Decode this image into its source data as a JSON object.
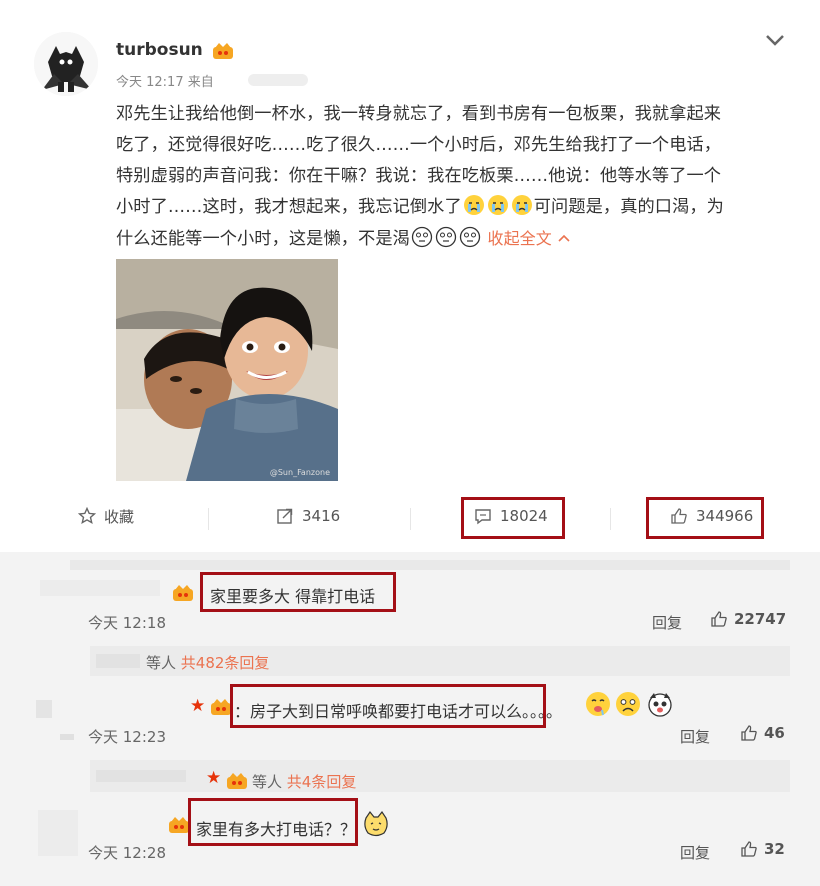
{
  "post": {
    "username": "turbosun",
    "time": "今天 12:17 来自",
    "lines": [
      "邓先生让我给他倒一杯水，我一转身就忘了，看到书房有一包板栗，我就拿起来",
      "吃了，还觉得很好吃……吃了很久……一个小时后，邓先生给我打了一个电话，",
      "特别虚弱的声音问我：你在干嘛？我说：我在吃板栗……他说：他等水等了一个",
      "小时了……这时，我才想起来，我忘记倒水了",
      "可问题是，真的口渴，为",
      "什么还能等一个小时，这是懒，不是渴"
    ],
    "collapse_label": "收起全文",
    "photo_watermark": "@Sun_Fanzone"
  },
  "actions": {
    "favorite_label": "收藏",
    "repost_count": "3416",
    "comment_count": "18024",
    "like_count": "344966"
  },
  "comments": [
    {
      "text": "家里要多大 得靠打电话",
      "time": "今天 12:18",
      "reply_label": "回复",
      "likes": "22747",
      "sub": "等人",
      "sub_count": "共482条回复"
    },
    {
      "text": "：房子大到日常呼唤都要打电话才可以么。。。。",
      "time": "今天 12:23",
      "reply_label": "回复",
      "likes": "46",
      "sub": "等人",
      "sub_count": "共4条回复"
    },
    {
      "text": "家里有多大打电话？？",
      "time": "今天 12:28",
      "reply_label": "回复",
      "likes": "32"
    }
  ],
  "colors": {
    "highlight_box": "#a40f16",
    "accent_orange": "#eb7350",
    "comment_bg": "#f3f3f3"
  },
  "icons": [
    "vip-crown-icon",
    "chevron-down-icon",
    "star-outline-icon",
    "repost-icon",
    "comment-icon",
    "thumbs-up-icon",
    "cry-emoji-icon",
    "dizzy-emoji-icon"
  ]
}
